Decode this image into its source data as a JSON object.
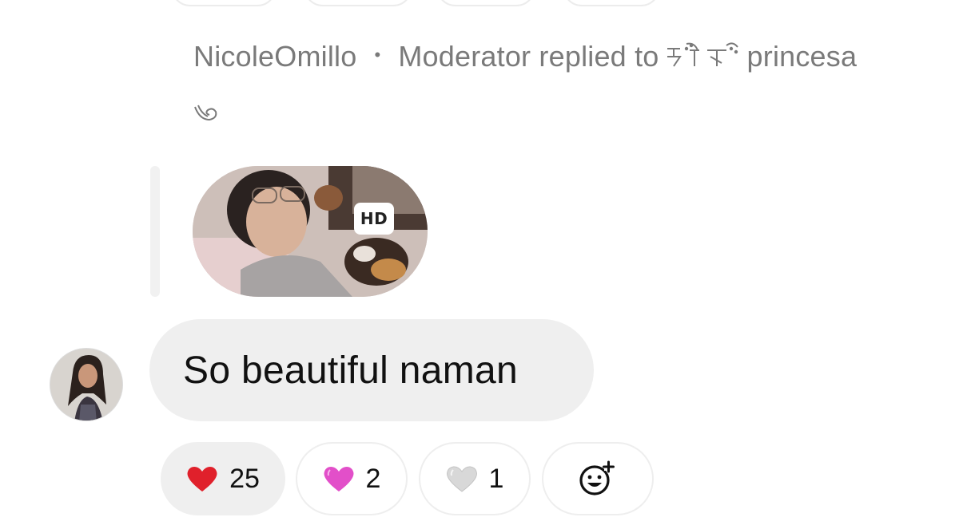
{
  "reply_header": {
    "author": "NicoleOmillo",
    "separator": "•",
    "role_text": "Moderator replied to",
    "target_name": "princesa"
  },
  "reply_media": {
    "badge": "HD"
  },
  "message": {
    "text": "So beautiful naman"
  },
  "reactions": [
    {
      "emoji_name": "red-heart",
      "color": "#e0202b",
      "count": "25",
      "active": true
    },
    {
      "emoji_name": "pink-heart",
      "color": "#e24fc9",
      "count": "2",
      "active": false
    },
    {
      "emoji_name": "white-heart",
      "color": "#d8d8d8",
      "count": "1",
      "active": false
    }
  ],
  "add_reaction": {
    "icon": "add-reaction-icon"
  }
}
